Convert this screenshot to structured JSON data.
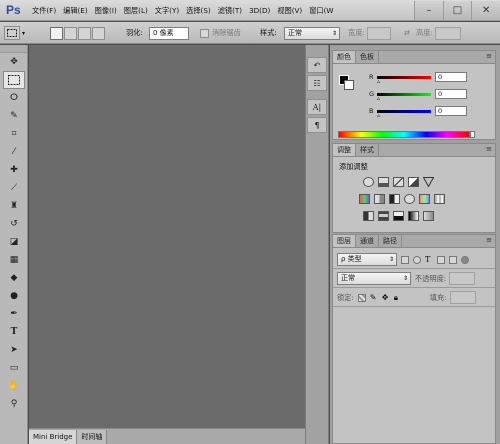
{
  "app": {
    "logo": "Ps"
  },
  "menu": {
    "items": [
      "文件(F)",
      "编辑(E)",
      "图像(I)",
      "图层(L)",
      "文字(Y)",
      "选择(S)",
      "滤镜(T)",
      "3D(D)",
      "视图(V)",
      "窗口(W"
    ]
  },
  "window_controls": {
    "minimize": "–",
    "restore": "□",
    "close": "✕"
  },
  "options": {
    "feather_label": "羽化:",
    "feather_value": "0 像素",
    "antialias_label": "消除锯齿",
    "style_label": "样式:",
    "style_value": "正常",
    "width_label": "宽度:",
    "height_label": "高度:"
  },
  "tools": [
    "move-icon",
    "marquee-icon",
    "lasso-icon",
    "quick-select-icon",
    "crop-icon",
    "eyedropper-icon",
    "healing-icon",
    "brush-icon",
    "stamp-icon",
    "history-brush-icon",
    "eraser-icon",
    "gradient-icon",
    "blur-icon",
    "dodge-icon",
    "pen-icon",
    "type-icon",
    "path-select-icon",
    "shape-icon",
    "hand-icon",
    "zoom-icon"
  ],
  "bottom_tabs": [
    "Mini Bridge",
    "时间轴"
  ],
  "color_panel": {
    "tabs": [
      "颜色",
      "色板"
    ],
    "channels": [
      {
        "label": "R",
        "value": "0",
        "gradient": [
          "#000000",
          "#ff0000"
        ]
      },
      {
        "label": "G",
        "value": "0",
        "gradient": [
          "#000000",
          "#00ff00"
        ]
      },
      {
        "label": "B",
        "value": "0",
        "gradient": [
          "#000000",
          "#0000ff"
        ]
      }
    ]
  },
  "adjustments_panel": {
    "tabs": [
      "调整",
      "样式"
    ],
    "title": "添加调整"
  },
  "layers_panel": {
    "tabs": [
      "图层",
      "通道",
      "路径"
    ],
    "filter_label": "ρ 类型",
    "blend_mode": "正常",
    "opacity_label": "不透明度:",
    "lock_label": "锁定:",
    "fill_label": "填充:"
  }
}
